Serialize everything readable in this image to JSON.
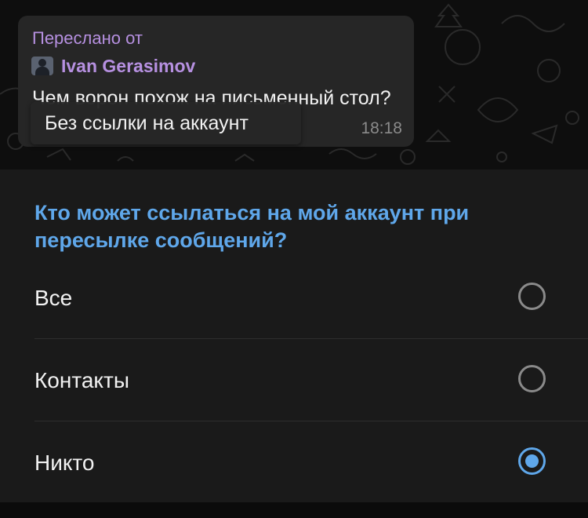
{
  "chat": {
    "forwarded_header": "Переслано от",
    "author": "Ivan Gerasimov",
    "message_text": "Чем ворон похож на письменный стол?",
    "time": "18:18",
    "tooltip": "Без ссылки на аккаунт"
  },
  "settings": {
    "title": "Кто может ссылаться на мой аккаунт при пересылке сообщений?",
    "options": [
      {
        "label": "Все",
        "selected": false
      },
      {
        "label": "Контакты",
        "selected": false
      },
      {
        "label": "Никто",
        "selected": true
      }
    ]
  },
  "colors": {
    "accent": "#5fa7ea",
    "forward_name": "#b690e0",
    "bubble": "#262626",
    "sheet_background": "#1a1a1a"
  }
}
